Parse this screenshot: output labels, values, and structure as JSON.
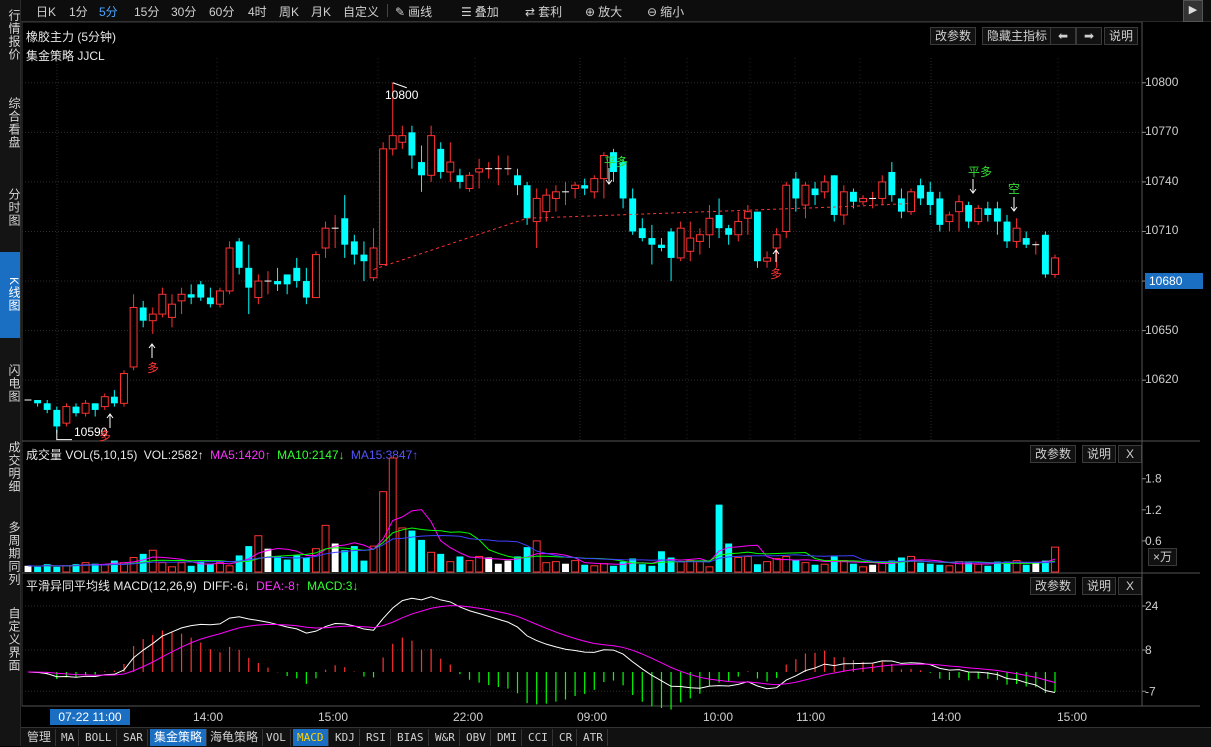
{
  "sidebar": [
    {
      "label": "行情报价",
      "name": "sidebar-item-quotes",
      "top": 4,
      "h": 62
    },
    {
      "label": "综合看盘",
      "name": "sidebar-item-overview",
      "top": 92,
      "h": 62
    },
    {
      "label": "分时图",
      "name": "sidebar-item-timeshare",
      "top": 182,
      "h": 50
    },
    {
      "label": "K线图",
      "name": "sidebar-item-kline",
      "top": 252,
      "h": 86,
      "active": true
    },
    {
      "label": "闪电图",
      "name": "sidebar-item-lightning",
      "top": 358,
      "h": 50
    },
    {
      "label": "成交明细",
      "name": "sidebar-item-trades",
      "top": 436,
      "h": 62
    },
    {
      "label": "多周期同列",
      "name": "sidebar-item-multiperiod",
      "top": 518,
      "h": 70
    },
    {
      "label": "自定义界面",
      "name": "sidebar-item-custom",
      "top": 604,
      "h": 70
    }
  ],
  "toolbar": {
    "periods": [
      "日K",
      "1分",
      "5分",
      "15分",
      "30分",
      "60分",
      "4时",
      "周K",
      "月K",
      "自定义"
    ],
    "selected_period": "5分",
    "tools": [
      {
        "label": "画线",
        "icon": "pencil-icon"
      },
      {
        "label": "叠加",
        "icon": "stack-icon"
      },
      {
        "label": "套利",
        "icon": "arbitrage-icon"
      },
      {
        "label": "放大",
        "icon": "zoom-in-icon"
      },
      {
        "label": "缩小",
        "icon": "zoom-out-icon"
      }
    ]
  },
  "main_panel": {
    "title": "橡胶主力 (5分钟)",
    "strategy": "集金策略 JJCL",
    "buttons": {
      "params": "改参数",
      "hide": "隐藏主指标",
      "help": "说明"
    },
    "last_price": "10680",
    "high_label": "10800",
    "low_label": "10590",
    "signals": {
      "ping_duo": "平多",
      "duo": "多",
      "kong": "空"
    }
  },
  "volume_panel": {
    "title": "成交量 VOL(5,10,15)",
    "vol": "VOL:2582↑",
    "ma5": "MA5:1420↑",
    "ma10": "MA10:2147↓",
    "ma15": "MA15:3847↑",
    "unit": "×万",
    "buttons": {
      "params": "改参数",
      "help": "说明",
      "close": "X"
    }
  },
  "macd_panel": {
    "title": "平滑异同平均线 MACD(12,26,9)",
    "diff": "DIFF:-6↓",
    "dea": "DEA:-8↑",
    "macd": "MACD:3↓",
    "buttons": {
      "params": "改参数",
      "help": "说明",
      "close": "X"
    }
  },
  "time_axis": {
    "cursor": "07-22 11:00",
    "labels": [
      "14:00",
      "15:00",
      "22:00",
      "09:00",
      "10:00",
      "11:00",
      "14:00",
      "15:00"
    ]
  },
  "bottom_tabs": [
    {
      "label": "管理",
      "cn": true
    },
    {
      "label": "MA"
    },
    {
      "label": "BOLL"
    },
    {
      "label": "SAR"
    },
    {
      "label": "集金策略",
      "cn": true,
      "sel": true
    },
    {
      "label": "海龟策略",
      "cn": true
    },
    {
      "label": "VOL"
    },
    {
      "label": "MACD",
      "sel2": true
    },
    {
      "label": "KDJ"
    },
    {
      "label": "RSI"
    },
    {
      "label": "BIAS"
    },
    {
      "label": "W&R"
    },
    {
      "label": "OBV"
    },
    {
      "label": "DMI"
    },
    {
      "label": "CCI"
    },
    {
      "label": "CR"
    },
    {
      "label": "ATR"
    }
  ],
  "colors": {
    "up": "#ff3232",
    "down": "#00ffff",
    "ma5": "#ff00ff",
    "ma10": "#00ff00",
    "ma15": "#4040ff",
    "accent": "#1b6fc2",
    "signal_green": "#33dd33"
  },
  "chart_data": [
    {
      "type": "candlestick",
      "title": "橡胶主力 (5分钟)",
      "y_ticks": [
        10800,
        10770,
        10740,
        10710,
        10680,
        10650,
        10620
      ],
      "ylim": [
        10585,
        10815
      ],
      "candles": [
        [
          10608,
          10608,
          10608,
          10608
        ],
        [
          10608,
          10608,
          10604,
          10606
        ],
        [
          10606,
          10608,
          10600,
          10602
        ],
        [
          10602,
          10604,
          10588,
          10592
        ],
        [
          10594,
          10606,
          10592,
          10604
        ],
        [
          10604,
          10606,
          10598,
          10600
        ],
        [
          10600,
          10608,
          10598,
          10606
        ],
        [
          10606,
          10606,
          10598,
          10602
        ],
        [
          10604,
          10612,
          10602,
          10610
        ],
        [
          10610,
          10614,
          10604,
          10606
        ],
        [
          10606,
          10626,
          10604,
          10624
        ],
        [
          10628,
          10672,
          10626,
          10664
        ],
        [
          10664,
          10668,
          10652,
          10656
        ],
        [
          10656,
          10664,
          10648,
          10660
        ],
        [
          10660,
          10676,
          10658,
          10672
        ],
        [
          10658,
          10672,
          10652,
          10666
        ],
        [
          10668,
          10676,
          10660,
          10672
        ],
        [
          10672,
          10678,
          10666,
          10670
        ],
        [
          10678,
          10680,
          10668,
          10670
        ],
        [
          10670,
          10676,
          10664,
          10666
        ],
        [
          10666,
          10676,
          10664,
          10674
        ],
        [
          10674,
          10704,
          10672,
          10700
        ],
        [
          10704,
          10706,
          10684,
          10688
        ],
        [
          10688,
          10702,
          10660,
          10676
        ],
        [
          10670,
          10684,
          10666,
          10680
        ],
        [
          10680,
          10686,
          10672,
          10680
        ],
        [
          10680,
          10688,
          10674,
          10678
        ],
        [
          10684,
          10680,
          10672,
          10678
        ],
        [
          10688,
          10694,
          10676,
          10680
        ],
        [
          10680,
          10688,
          10666,
          10670
        ],
        [
          10670,
          10698,
          10670,
          10696
        ],
        [
          10700,
          10716,
          10694,
          10712
        ],
        [
          10712,
          10720,
          10700,
          10712
        ],
        [
          10718,
          10732,
          10694,
          10702
        ],
        [
          10704,
          10708,
          10690,
          10696
        ],
        [
          10696,
          10704,
          10680,
          10692
        ],
        [
          10682,
          10712,
          10680,
          10700
        ],
        [
          10690,
          10764,
          10690,
          10760
        ],
        [
          10760,
          10800,
          10756,
          10768
        ],
        [
          10764,
          10774,
          10760,
          10768
        ],
        [
          10770,
          10774,
          10748,
          10756
        ],
        [
          10752,
          10762,
          10734,
          10744
        ],
        [
          10744,
          10774,
          10740,
          10768
        ],
        [
          10760,
          10764,
          10742,
          10746
        ],
        [
          10746,
          10764,
          10740,
          10752
        ],
        [
          10744,
          10748,
          10736,
          10740
        ],
        [
          10736,
          10746,
          10734,
          10744
        ],
        [
          10746,
          10754,
          10736,
          10748
        ],
        [
          10748,
          10752,
          10742,
          10748
        ],
        [
          10748,
          10756,
          10738,
          10748
        ],
        [
          10748,
          10756,
          10744,
          10748
        ],
        [
          10744,
          10748,
          10732,
          10738
        ],
        [
          10738,
          10740,
          10714,
          10718
        ],
        [
          10716,
          10736,
          10700,
          10730
        ],
        [
          10722,
          10736,
          10716,
          10732
        ],
        [
          10730,
          10738,
          10722,
          10734
        ],
        [
          10734,
          10740,
          10726,
          10734
        ],
        [
          10736,
          10740,
          10730,
          10738
        ],
        [
          10738,
          10742,
          10732,
          10736
        ],
        [
          10734,
          10744,
          10730,
          10742
        ],
        [
          10742,
          10758,
          10730,
          10756
        ],
        [
          10758,
          10760,
          10740,
          10746
        ],
        [
          10752,
          10754,
          10724,
          10730
        ],
        [
          10730,
          10736,
          10708,
          10710
        ],
        [
          10712,
          10718,
          10704,
          10706
        ],
        [
          10706,
          10714,
          10690,
          10702
        ],
        [
          10702,
          10706,
          10698,
          10700
        ],
        [
          10710,
          10712,
          10680,
          10694
        ],
        [
          10694,
          10716,
          10692,
          10712
        ],
        [
          10698,
          10716,
          10692,
          10706
        ],
        [
          10704,
          10712,
          10696,
          10708
        ],
        [
          10708,
          10726,
          10700,
          10718
        ],
        [
          10720,
          10730,
          10706,
          10712
        ],
        [
          10712,
          10714,
          10702,
          10708
        ],
        [
          10708,
          10722,
          10704,
          10716
        ],
        [
          10718,
          10726,
          10708,
          10722
        ],
        [
          10722,
          10722,
          10688,
          10692
        ],
        [
          10692,
          10698,
          10688,
          10694
        ],
        [
          10700,
          10712,
          10688,
          10708
        ],
        [
          10710,
          10740,
          10706,
          10738
        ],
        [
          10742,
          10746,
          10722,
          10730
        ],
        [
          10726,
          10740,
          10718,
          10738
        ],
        [
          10736,
          10740,
          10726,
          10732
        ],
        [
          10734,
          10744,
          10730,
          10740
        ],
        [
          10744,
          10744,
          10716,
          10720
        ],
        [
          10720,
          10738,
          10714,
          10734
        ],
        [
          10734,
          10736,
          10724,
          10728
        ],
        [
          10728,
          10732,
          10726,
          10730
        ],
        [
          10730,
          10734,
          10724,
          10730
        ],
        [
          10730,
          10744,
          10726,
          10740
        ],
        [
          10746,
          10752,
          10728,
          10732
        ],
        [
          10730,
          10736,
          10718,
          10722
        ],
        [
          10722,
          10736,
          10720,
          10734
        ],
        [
          10738,
          10742,
          10726,
          10730
        ],
        [
          10734,
          10740,
          10720,
          10726
        ],
        [
          10730,
          10734,
          10710,
          10714
        ],
        [
          10716,
          10722,
          10710,
          10720
        ],
        [
          10722,
          10732,
          10710,
          10728
        ],
        [
          10726,
          10728,
          10712,
          10716
        ],
        [
          10716,
          10726,
          10714,
          10724
        ],
        [
          10724,
          10728,
          10716,
          10720
        ],
        [
          10724,
          10728,
          10708,
          10716
        ],
        [
          10716,
          10720,
          10700,
          10704
        ],
        [
          10704,
          10718,
          10700,
          10712
        ],
        [
          10706,
          10710,
          10700,
          10702
        ],
        [
          10702,
          10704,
          10696,
          10702
        ],
        [
          10708,
          10710,
          10682,
          10684
        ],
        [
          10684,
          10696,
          10682,
          10694
        ]
      ]
    },
    {
      "type": "bar",
      "title": "成交量 VOL(5,10,15)",
      "y_ticks": [
        1.8,
        1.2,
        0.6
      ],
      "ylim": [
        0,
        2.2
      ],
      "values": [
        0.12,
        0.1,
        0.15,
        0.1,
        0.12,
        0.15,
        0.18,
        0.16,
        0.14,
        0.22,
        0.18,
        0.28,
        0.35,
        0.42,
        0.18,
        0.1,
        0.18,
        0.12,
        0.2,
        0.16,
        0.18,
        0.12,
        0.32,
        0.5,
        0.7,
        0.45,
        0.3,
        0.24,
        0.32,
        0.28,
        0.45,
        0.9,
        0.55,
        0.42,
        0.5,
        0.22,
        0.5,
        1.55,
        2.2,
        0.85,
        0.8,
        0.62,
        0.38,
        0.35,
        0.2,
        0.3,
        0.22,
        0.3,
        0.28,
        0.16,
        0.22,
        0.3,
        0.48,
        0.6,
        0.18,
        0.2,
        0.16,
        0.22,
        0.14,
        0.12,
        0.16,
        0.12,
        0.2,
        0.26,
        0.15,
        0.12,
        0.4,
        0.28,
        0.2,
        0.22,
        0.2,
        0.1,
        1.3,
        0.55,
        0.28,
        0.3,
        0.15,
        0.2,
        0.26,
        0.3,
        0.24,
        0.18,
        0.14,
        0.15,
        0.3,
        0.22,
        0.16,
        0.1,
        0.14,
        0.2,
        0.22,
        0.28,
        0.3,
        0.18,
        0.16,
        0.14,
        0.12,
        0.2,
        0.18,
        0.15,
        0.12,
        0.2,
        0.2,
        0.22,
        0.14,
        0.18,
        0.22,
        0.48,
        0.2,
        0.28,
        0.22,
        0.2,
        0.3,
        0.46,
        0.56,
        0.34
      ]
    },
    {
      "type": "line",
      "title": "平滑异同平均线 MACD(12,26,9)",
      "y_ticks": [
        24,
        8,
        -7
      ],
      "ylim": [
        -12,
        28
      ]
    }
  ]
}
